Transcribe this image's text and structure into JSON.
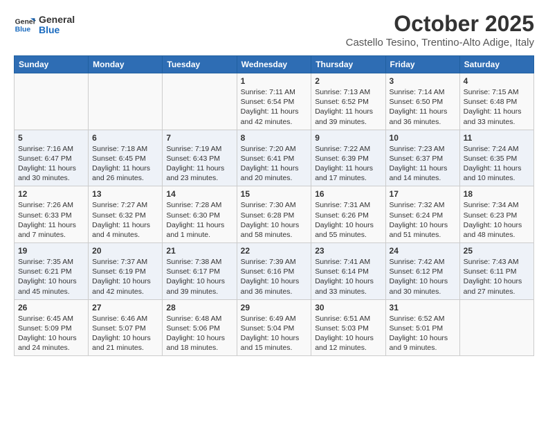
{
  "header": {
    "logo": {
      "line1": "General",
      "line2": "Blue"
    },
    "title": "October 2025",
    "location": "Castello Tesino, Trentino-Alto Adige, Italy"
  },
  "days_of_week": [
    "Sunday",
    "Monday",
    "Tuesday",
    "Wednesday",
    "Thursday",
    "Friday",
    "Saturday"
  ],
  "weeks": [
    [
      {
        "day": "",
        "info": ""
      },
      {
        "day": "",
        "info": ""
      },
      {
        "day": "",
        "info": ""
      },
      {
        "day": "1",
        "info": "Sunrise: 7:11 AM\nSunset: 6:54 PM\nDaylight: 11 hours and 42 minutes."
      },
      {
        "day": "2",
        "info": "Sunrise: 7:13 AM\nSunset: 6:52 PM\nDaylight: 11 hours and 39 minutes."
      },
      {
        "day": "3",
        "info": "Sunrise: 7:14 AM\nSunset: 6:50 PM\nDaylight: 11 hours and 36 minutes."
      },
      {
        "day": "4",
        "info": "Sunrise: 7:15 AM\nSunset: 6:48 PM\nDaylight: 11 hours and 33 minutes."
      }
    ],
    [
      {
        "day": "5",
        "info": "Sunrise: 7:16 AM\nSunset: 6:47 PM\nDaylight: 11 hours and 30 minutes."
      },
      {
        "day": "6",
        "info": "Sunrise: 7:18 AM\nSunset: 6:45 PM\nDaylight: 11 hours and 26 minutes."
      },
      {
        "day": "7",
        "info": "Sunrise: 7:19 AM\nSunset: 6:43 PM\nDaylight: 11 hours and 23 minutes."
      },
      {
        "day": "8",
        "info": "Sunrise: 7:20 AM\nSunset: 6:41 PM\nDaylight: 11 hours and 20 minutes."
      },
      {
        "day": "9",
        "info": "Sunrise: 7:22 AM\nSunset: 6:39 PM\nDaylight: 11 hours and 17 minutes."
      },
      {
        "day": "10",
        "info": "Sunrise: 7:23 AM\nSunset: 6:37 PM\nDaylight: 11 hours and 14 minutes."
      },
      {
        "day": "11",
        "info": "Sunrise: 7:24 AM\nSunset: 6:35 PM\nDaylight: 11 hours and 10 minutes."
      }
    ],
    [
      {
        "day": "12",
        "info": "Sunrise: 7:26 AM\nSunset: 6:33 PM\nDaylight: 11 hours and 7 minutes."
      },
      {
        "day": "13",
        "info": "Sunrise: 7:27 AM\nSunset: 6:32 PM\nDaylight: 11 hours and 4 minutes."
      },
      {
        "day": "14",
        "info": "Sunrise: 7:28 AM\nSunset: 6:30 PM\nDaylight: 11 hours and 1 minute."
      },
      {
        "day": "15",
        "info": "Sunrise: 7:30 AM\nSunset: 6:28 PM\nDaylight: 10 hours and 58 minutes."
      },
      {
        "day": "16",
        "info": "Sunrise: 7:31 AM\nSunset: 6:26 PM\nDaylight: 10 hours and 55 minutes."
      },
      {
        "day": "17",
        "info": "Sunrise: 7:32 AM\nSunset: 6:24 PM\nDaylight: 10 hours and 51 minutes."
      },
      {
        "day": "18",
        "info": "Sunrise: 7:34 AM\nSunset: 6:23 PM\nDaylight: 10 hours and 48 minutes."
      }
    ],
    [
      {
        "day": "19",
        "info": "Sunrise: 7:35 AM\nSunset: 6:21 PM\nDaylight: 10 hours and 45 minutes."
      },
      {
        "day": "20",
        "info": "Sunrise: 7:37 AM\nSunset: 6:19 PM\nDaylight: 10 hours and 42 minutes."
      },
      {
        "day": "21",
        "info": "Sunrise: 7:38 AM\nSunset: 6:17 PM\nDaylight: 10 hours and 39 minutes."
      },
      {
        "day": "22",
        "info": "Sunrise: 7:39 AM\nSunset: 6:16 PM\nDaylight: 10 hours and 36 minutes."
      },
      {
        "day": "23",
        "info": "Sunrise: 7:41 AM\nSunset: 6:14 PM\nDaylight: 10 hours and 33 minutes."
      },
      {
        "day": "24",
        "info": "Sunrise: 7:42 AM\nSunset: 6:12 PM\nDaylight: 10 hours and 30 minutes."
      },
      {
        "day": "25",
        "info": "Sunrise: 7:43 AM\nSunset: 6:11 PM\nDaylight: 10 hours and 27 minutes."
      }
    ],
    [
      {
        "day": "26",
        "info": "Sunrise: 6:45 AM\nSunset: 5:09 PM\nDaylight: 10 hours and 24 minutes."
      },
      {
        "day": "27",
        "info": "Sunrise: 6:46 AM\nSunset: 5:07 PM\nDaylight: 10 hours and 21 minutes."
      },
      {
        "day": "28",
        "info": "Sunrise: 6:48 AM\nSunset: 5:06 PM\nDaylight: 10 hours and 18 minutes."
      },
      {
        "day": "29",
        "info": "Sunrise: 6:49 AM\nSunset: 5:04 PM\nDaylight: 10 hours and 15 minutes."
      },
      {
        "day": "30",
        "info": "Sunrise: 6:51 AM\nSunset: 5:03 PM\nDaylight: 10 hours and 12 minutes."
      },
      {
        "day": "31",
        "info": "Sunrise: 6:52 AM\nSunset: 5:01 PM\nDaylight: 10 hours and 9 minutes."
      },
      {
        "day": "",
        "info": ""
      }
    ]
  ]
}
